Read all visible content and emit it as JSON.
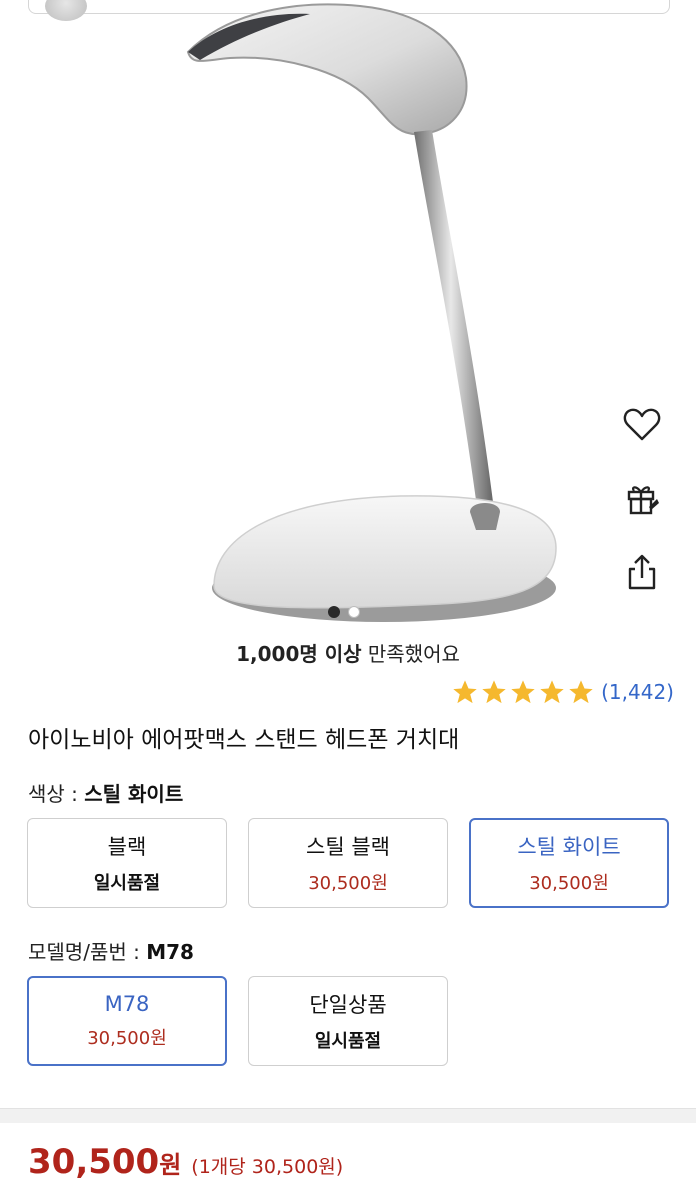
{
  "satisfaction": {
    "count": "1,000명 이상",
    "text": "만족했어요"
  },
  "rating": {
    "stars": 5,
    "review_count": "(1,442)"
  },
  "product": {
    "title": "아이노비아 에어팟맥스 스탠드 헤드폰 거치대"
  },
  "color_option": {
    "label": "색상 :",
    "selected": "스틸 화이트",
    "choices": [
      {
        "name": "블랙",
        "status": "일시품절"
      },
      {
        "name": "스틸 블랙",
        "price": "30,500원"
      },
      {
        "name": "스틸 화이트",
        "price": "30,500원"
      }
    ]
  },
  "model_option": {
    "label": "모델명/품번 :",
    "selected": "M78",
    "choices": [
      {
        "name": "M78",
        "price": "30,500원"
      },
      {
        "name": "단일상품",
        "status": "일시품절"
      }
    ]
  },
  "price": {
    "amount": "30,500",
    "unit": "원",
    "per_unit": "(1개당 30,500원)"
  },
  "carousel": {
    "total": 2,
    "current": 1
  },
  "icons": [
    "heart-icon",
    "gift-icon",
    "share-icon"
  ],
  "colors": {
    "accent_blue": "#3a64c2",
    "price_red": "#b0241b",
    "star": "#f5b82e"
  }
}
